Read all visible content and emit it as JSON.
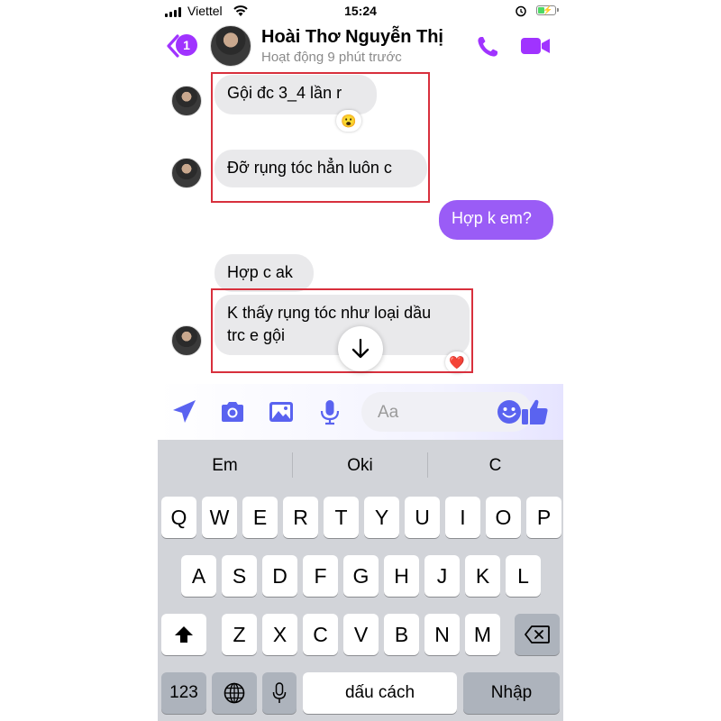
{
  "status_bar": {
    "carrier": "Viettel",
    "time": "15:24"
  },
  "header": {
    "back_badge": "1",
    "contact_name": "Hoài Thơ Nguyễn Thị",
    "contact_status": "Hoạt động 9 phút trước",
    "accent_color": "#a033ff"
  },
  "messages": [
    {
      "direction": "incoming",
      "text": "Gội đc 3_4 lần r",
      "reaction": "😮"
    },
    {
      "direction": "incoming",
      "text": "Đỡ rụng tóc hẳn luôn c"
    },
    {
      "direction": "outgoing",
      "text": "Hợp k em?"
    },
    {
      "direction": "incoming",
      "text": "Hợp c ak"
    },
    {
      "direction": "incoming",
      "text_line1": "K thấy rụng tóc như loại dầu",
      "text_line2": "trc e gội",
      "reaction": "❤️"
    }
  ],
  "composer": {
    "placeholder": "Aa",
    "icons": [
      "send-arrow-icon",
      "camera-icon",
      "image-icon",
      "microphone-icon",
      "emoji-icon",
      "thumbs-up-icon"
    ]
  },
  "keyboard": {
    "suggestions": [
      "Em",
      "Oki",
      "C"
    ],
    "row1": [
      "Q",
      "W",
      "E",
      "R",
      "T",
      "Y",
      "U",
      "I",
      "O",
      "P"
    ],
    "row2": [
      "A",
      "S",
      "D",
      "F",
      "G",
      "H",
      "J",
      "K",
      "L"
    ],
    "row3": [
      "Z",
      "X",
      "C",
      "V",
      "B",
      "N",
      "M"
    ],
    "numbers_key": "123",
    "space_key": "dấu cách",
    "return_key": "Nhập"
  }
}
